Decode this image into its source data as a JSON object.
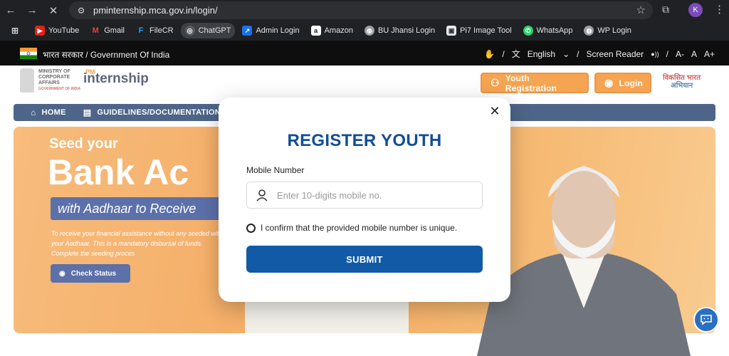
{
  "browser": {
    "url": "pminternship.mca.gov.in/login/",
    "profile_initial": "K",
    "bookmarks": [
      {
        "label": "YouTube",
        "icon": "youtube-icon",
        "color": "#e62117"
      },
      {
        "label": "Gmail",
        "icon": "gmail-icon",
        "color": "#ea4335"
      },
      {
        "label": "FileCR",
        "icon": "filecr-icon",
        "color": "#18a0fb"
      },
      {
        "label": "ChatGPT",
        "icon": "chatgpt-icon",
        "color": "#5c5c5c"
      },
      {
        "label": "Admin Login",
        "icon": "admin-icon",
        "color": "#1a73e8"
      },
      {
        "label": "Amazon",
        "icon": "amazon-icon",
        "color": "#ffffff"
      },
      {
        "label": "BU Jhansi Login",
        "icon": "globe-icon",
        "color": "#9aa0a6"
      },
      {
        "label": "Pi7 Image Tool",
        "icon": "image-icon",
        "color": "#9aa0a6"
      },
      {
        "label": "WhatsApp",
        "icon": "whatsapp-icon",
        "color": "#25d366"
      },
      {
        "label": "WP Login",
        "icon": "globe-icon",
        "color": "#9aa0a6"
      }
    ]
  },
  "gov_bar": {
    "text": "भारत सरकार / Government Of India",
    "language": "English",
    "screen_reader": "Screen Reader",
    "font_small": "A-",
    "font_normal": "A",
    "font_large": "A+"
  },
  "header": {
    "mca_lines": [
      "MINISTRY OF",
      "CORPORATE",
      "AFFAIRS"
    ],
    "mca_gov": "GOVERNMENT OF INDIA",
    "pm_label": "PM",
    "internship_label": "internship",
    "youth_registration": "Youth Registration",
    "login": "Login",
    "vb_line1": "विकसित भारत",
    "vb_line2": "अभियान"
  },
  "nav": {
    "home": "HOME",
    "guidelines": "GUIDELINES/DOCUMENTATIONS"
  },
  "hero": {
    "seed": "Seed your",
    "bank": "Bank Ac",
    "band": "with Aadhaar to Receive",
    "desc": "To receive your financial assistance without any seeded with your Aadhaar. This is a mandatory disbursal of funds. Complete the seeding proces",
    "check_status": "Check Status"
  },
  "modal": {
    "title": "REGISTER YOUTH",
    "mobile_label": "Mobile Number",
    "mobile_placeholder": "Enter 10-digits mobile no.",
    "mobile_value": "",
    "confirm_text": "I confirm that the provided mobile number is unique.",
    "submit": "SUBMIT"
  },
  "colors": {
    "primary_blue": "#124e96",
    "button_blue": "#125aa6",
    "orange": "#f1820f",
    "nav_navy": "#0b2a5c"
  }
}
